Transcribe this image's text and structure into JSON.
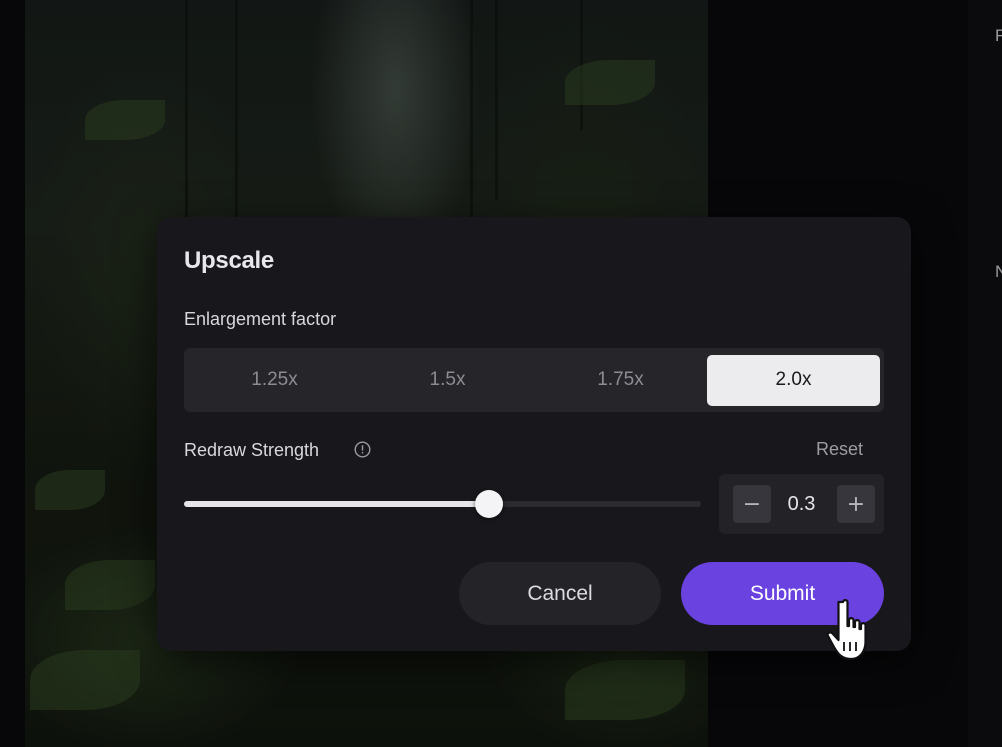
{
  "right_panel": {
    "letters": [
      "F",
      "N"
    ]
  },
  "dialog": {
    "title": "Upscale",
    "enlargement": {
      "label": "Enlargement factor",
      "options": [
        "1.25x",
        "1.5x",
        "1.75x",
        "2.0x"
      ],
      "selected": "2.0x"
    },
    "redraw": {
      "label": "Redraw Strength",
      "info_icon": "info-icon",
      "reset_label": "Reset",
      "slider_fraction": 0.59,
      "value": "0.3",
      "decrement_icon": "minus-icon",
      "decrement_label": "−",
      "increment_icon": "plus-icon",
      "increment_label": "+"
    },
    "cancel_label": "Cancel",
    "submit_label": "Submit",
    "submit_color": "#6a42e0"
  }
}
